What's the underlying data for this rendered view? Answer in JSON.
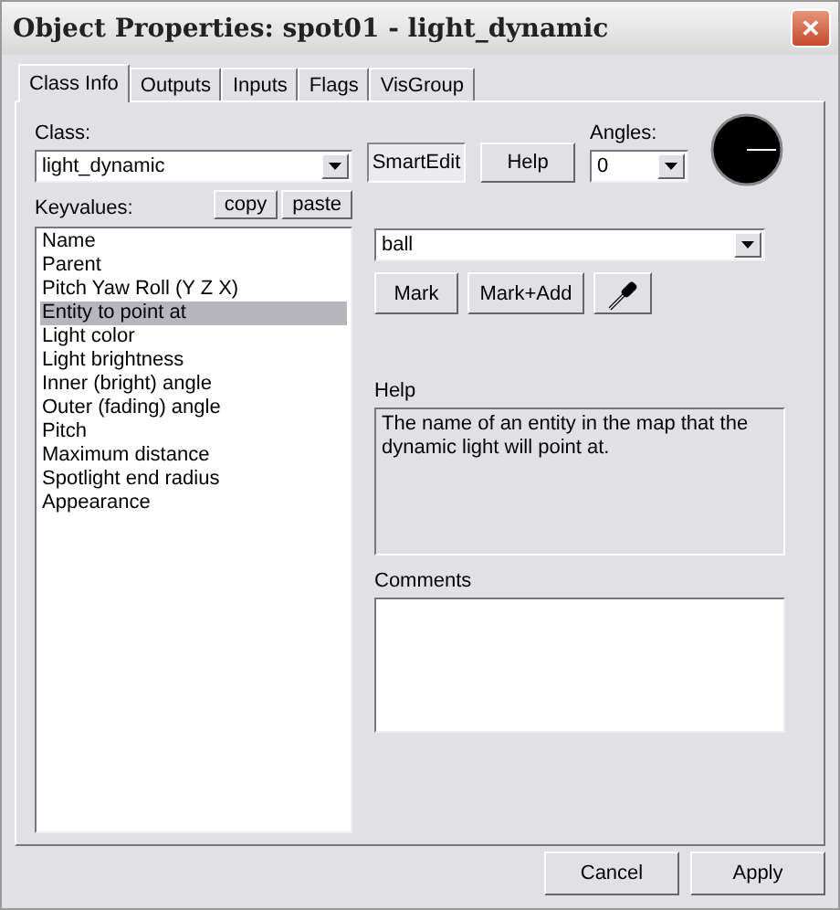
{
  "window": {
    "title": "Object Properties: spot01 - light_dynamic",
    "close": "✕"
  },
  "tabs": [
    {
      "label": "Class Info",
      "selected": true
    },
    {
      "label": "Outputs",
      "selected": false
    },
    {
      "label": "Inputs",
      "selected": false
    },
    {
      "label": "Flags",
      "selected": false
    },
    {
      "label": "VisGroup",
      "selected": false
    }
  ],
  "class": {
    "label": "Class:",
    "value": "light_dynamic"
  },
  "smartedit": {
    "label": "SmartEdit",
    "on": true
  },
  "help_button": "Help",
  "angles": {
    "label": "Angles:",
    "value": "0"
  },
  "keyvalues": {
    "label": "Keyvalues:",
    "copy": "copy",
    "paste": "paste",
    "items": [
      {
        "label": "Name",
        "selected": false
      },
      {
        "label": "Parent",
        "selected": false
      },
      {
        "label": "Pitch Yaw Roll (Y Z X)",
        "selected": false
      },
      {
        "label": "Entity to point at",
        "selected": true
      },
      {
        "label": "Light color",
        "selected": false
      },
      {
        "label": "Light brightness",
        "selected": false
      },
      {
        "label": "Inner (bright) angle",
        "selected": false
      },
      {
        "label": "Outer (fading) angle",
        "selected": false
      },
      {
        "label": "Pitch",
        "selected": false
      },
      {
        "label": "Maximum distance",
        "selected": false
      },
      {
        "label": "Spotlight end radius",
        "selected": false
      },
      {
        "label": "Appearance",
        "selected": false
      }
    ]
  },
  "value": {
    "value": "ball",
    "mark": "Mark",
    "mark_add": "Mark+Add"
  },
  "help": {
    "label": "Help",
    "text": "The name of an entity in the map that the dynamic light will point at."
  },
  "comments": {
    "label": "Comments"
  },
  "buttons": [
    "Cancel",
    "Apply"
  ]
}
